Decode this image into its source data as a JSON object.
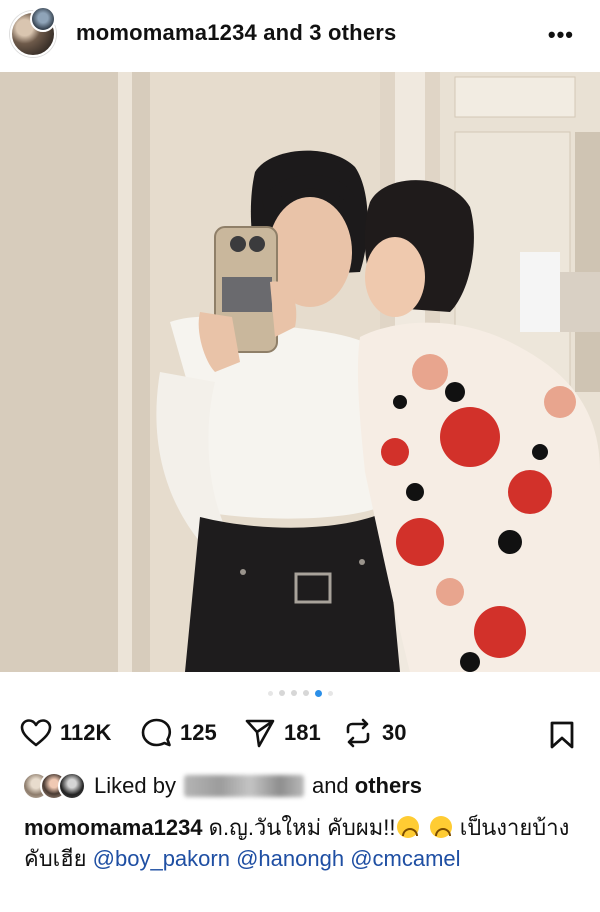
{
  "post": {
    "username": "momomama1234",
    "coauthors_text": "and 3 others",
    "more_label": "•••"
  },
  "carousel": {
    "total": 6,
    "active_index": 4
  },
  "actions": {
    "likes": "112K",
    "comments": "125",
    "shares": "181",
    "reposts": "30"
  },
  "liked_by": {
    "prefix": "Liked by",
    "and_label": "and",
    "others_label": "others"
  },
  "caption": {
    "username": "momomama1234",
    "text_1": "ด.ญ.วันใหม่ คับผม!!",
    "text_2": "เป็นงายบ้างคับเฮีย",
    "mentions": [
      "@boy_pakorn",
      "@hanongh",
      "@cmcamel"
    ]
  },
  "icons": {
    "like": "heart-icon",
    "comment": "comment-icon",
    "share": "send-icon",
    "repost": "repost-icon",
    "save": "bookmark-icon",
    "emoji": "upside-down-face-emoji"
  },
  "colors": {
    "mention": "#1f4fa3",
    "active_dot": "#2b8fe8"
  }
}
